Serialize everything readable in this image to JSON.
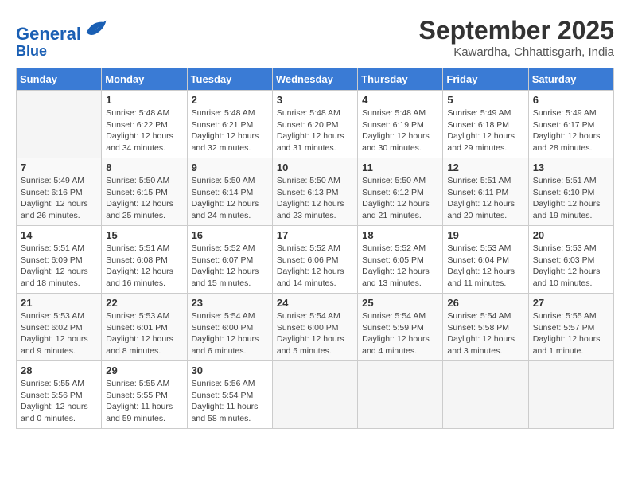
{
  "header": {
    "logo_line1": "General",
    "logo_line2": "Blue",
    "title": "September 2025",
    "subtitle": "Kawardha, Chhattisgarh, India"
  },
  "days_of_week": [
    "Sunday",
    "Monday",
    "Tuesday",
    "Wednesday",
    "Thursday",
    "Friday",
    "Saturday"
  ],
  "weeks": [
    [
      {
        "day": "",
        "info": ""
      },
      {
        "day": "1",
        "info": "Sunrise: 5:48 AM\nSunset: 6:22 PM\nDaylight: 12 hours\nand 34 minutes."
      },
      {
        "day": "2",
        "info": "Sunrise: 5:48 AM\nSunset: 6:21 PM\nDaylight: 12 hours\nand 32 minutes."
      },
      {
        "day": "3",
        "info": "Sunrise: 5:48 AM\nSunset: 6:20 PM\nDaylight: 12 hours\nand 31 minutes."
      },
      {
        "day": "4",
        "info": "Sunrise: 5:48 AM\nSunset: 6:19 PM\nDaylight: 12 hours\nand 30 minutes."
      },
      {
        "day": "5",
        "info": "Sunrise: 5:49 AM\nSunset: 6:18 PM\nDaylight: 12 hours\nand 29 minutes."
      },
      {
        "day": "6",
        "info": "Sunrise: 5:49 AM\nSunset: 6:17 PM\nDaylight: 12 hours\nand 28 minutes."
      }
    ],
    [
      {
        "day": "7",
        "info": "Sunrise: 5:49 AM\nSunset: 6:16 PM\nDaylight: 12 hours\nand 26 minutes."
      },
      {
        "day": "8",
        "info": "Sunrise: 5:50 AM\nSunset: 6:15 PM\nDaylight: 12 hours\nand 25 minutes."
      },
      {
        "day": "9",
        "info": "Sunrise: 5:50 AM\nSunset: 6:14 PM\nDaylight: 12 hours\nand 24 minutes."
      },
      {
        "day": "10",
        "info": "Sunrise: 5:50 AM\nSunset: 6:13 PM\nDaylight: 12 hours\nand 23 minutes."
      },
      {
        "day": "11",
        "info": "Sunrise: 5:50 AM\nSunset: 6:12 PM\nDaylight: 12 hours\nand 21 minutes."
      },
      {
        "day": "12",
        "info": "Sunrise: 5:51 AM\nSunset: 6:11 PM\nDaylight: 12 hours\nand 20 minutes."
      },
      {
        "day": "13",
        "info": "Sunrise: 5:51 AM\nSunset: 6:10 PM\nDaylight: 12 hours\nand 19 minutes."
      }
    ],
    [
      {
        "day": "14",
        "info": "Sunrise: 5:51 AM\nSunset: 6:09 PM\nDaylight: 12 hours\nand 18 minutes."
      },
      {
        "day": "15",
        "info": "Sunrise: 5:51 AM\nSunset: 6:08 PM\nDaylight: 12 hours\nand 16 minutes."
      },
      {
        "day": "16",
        "info": "Sunrise: 5:52 AM\nSunset: 6:07 PM\nDaylight: 12 hours\nand 15 minutes."
      },
      {
        "day": "17",
        "info": "Sunrise: 5:52 AM\nSunset: 6:06 PM\nDaylight: 12 hours\nand 14 minutes."
      },
      {
        "day": "18",
        "info": "Sunrise: 5:52 AM\nSunset: 6:05 PM\nDaylight: 12 hours\nand 13 minutes."
      },
      {
        "day": "19",
        "info": "Sunrise: 5:53 AM\nSunset: 6:04 PM\nDaylight: 12 hours\nand 11 minutes."
      },
      {
        "day": "20",
        "info": "Sunrise: 5:53 AM\nSunset: 6:03 PM\nDaylight: 12 hours\nand 10 minutes."
      }
    ],
    [
      {
        "day": "21",
        "info": "Sunrise: 5:53 AM\nSunset: 6:02 PM\nDaylight: 12 hours\nand 9 minutes."
      },
      {
        "day": "22",
        "info": "Sunrise: 5:53 AM\nSunset: 6:01 PM\nDaylight: 12 hours\nand 8 minutes."
      },
      {
        "day": "23",
        "info": "Sunrise: 5:54 AM\nSunset: 6:00 PM\nDaylight: 12 hours\nand 6 minutes."
      },
      {
        "day": "24",
        "info": "Sunrise: 5:54 AM\nSunset: 6:00 PM\nDaylight: 12 hours\nand 5 minutes."
      },
      {
        "day": "25",
        "info": "Sunrise: 5:54 AM\nSunset: 5:59 PM\nDaylight: 12 hours\nand 4 minutes."
      },
      {
        "day": "26",
        "info": "Sunrise: 5:54 AM\nSunset: 5:58 PM\nDaylight: 12 hours\nand 3 minutes."
      },
      {
        "day": "27",
        "info": "Sunrise: 5:55 AM\nSunset: 5:57 PM\nDaylight: 12 hours\nand 1 minute."
      }
    ],
    [
      {
        "day": "28",
        "info": "Sunrise: 5:55 AM\nSunset: 5:56 PM\nDaylight: 12 hours\nand 0 minutes."
      },
      {
        "day": "29",
        "info": "Sunrise: 5:55 AM\nSunset: 5:55 PM\nDaylight: 11 hours\nand 59 minutes."
      },
      {
        "day": "30",
        "info": "Sunrise: 5:56 AM\nSunset: 5:54 PM\nDaylight: 11 hours\nand 58 minutes."
      },
      {
        "day": "",
        "info": ""
      },
      {
        "day": "",
        "info": ""
      },
      {
        "day": "",
        "info": ""
      },
      {
        "day": "",
        "info": ""
      }
    ]
  ]
}
